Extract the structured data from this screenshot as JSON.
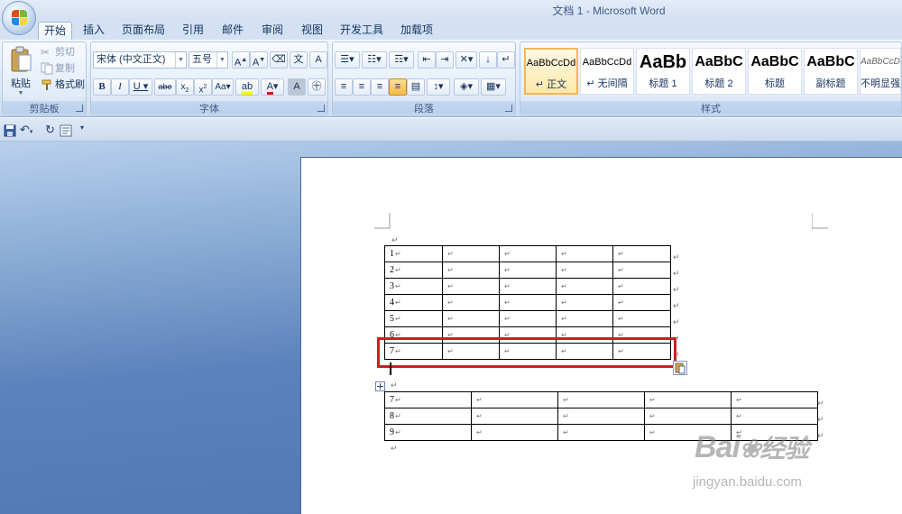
{
  "window": {
    "title": "文档 1 - Microsoft Word"
  },
  "tabs": [
    "开始",
    "插入",
    "页面布局",
    "引用",
    "邮件",
    "审阅",
    "视图",
    "开发工具",
    "加载项"
  ],
  "clipboard": {
    "label": "剪贴板",
    "paste": "粘贴",
    "cut": "剪切",
    "copy": "复制",
    "format_painter": "格式刷"
  },
  "font": {
    "label": "字体",
    "font_name": "宋体 (中文正文)",
    "font_size": "五号"
  },
  "paragraph": {
    "label": "段落"
  },
  "styles": {
    "label": "样式",
    "items": [
      {
        "sample": "AaBbCcDd",
        "name": "↵ 正文"
      },
      {
        "sample": "AaBbCcDd",
        "name": "↵ 无间隔"
      },
      {
        "sample": "AaBb",
        "name": "标题 1"
      },
      {
        "sample": "AaBbC",
        "name": "标题 2"
      },
      {
        "sample": "AaBbC",
        "name": "标题"
      },
      {
        "sample": "AaBbC",
        "name": "副标题"
      },
      {
        "sample": "AaBbCcDd",
        "name": "不明显强调"
      }
    ]
  },
  "document": {
    "mark": "↵",
    "table1": [
      "1",
      "2",
      "3",
      "4",
      "5",
      "6",
      "7"
    ],
    "table2": [
      "7",
      "8",
      "9"
    ]
  },
  "watermark": {
    "logo": "Bai",
    "logo_cn": "经验",
    "url": "jingyan.baidu.com"
  },
  "colors": {
    "highlight": "#cc1f1f",
    "ribbon": "#dbe7f6",
    "workspace": "#5b82bb"
  }
}
